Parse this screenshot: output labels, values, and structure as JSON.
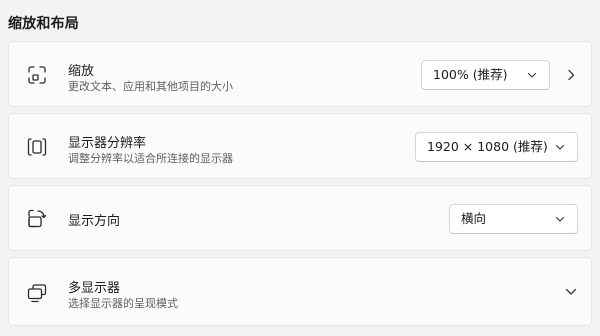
{
  "section": {
    "title": "缩放和布局"
  },
  "rows": [
    {
      "title": "缩放",
      "subtitle": "更改文本、应用和其他项目的大小",
      "icon": "scale-icon",
      "control": {
        "type": "dropdown",
        "value": "100% (推荐)"
      },
      "has_nav_chevron": true
    },
    {
      "title": "显示器分辨率",
      "subtitle": "调整分辨率以适合所连接的显示器",
      "icon": "resolution-icon",
      "control": {
        "type": "dropdown",
        "value": "1920 × 1080 (推荐)"
      }
    },
    {
      "title": "显示方向",
      "icon": "orientation-icon",
      "control": {
        "type": "dropdown",
        "value": "横向"
      }
    },
    {
      "title": "多显示器",
      "subtitle": "选择显示器的呈现模式",
      "icon": "multiple-displays-icon",
      "control": {
        "type": "expander"
      }
    }
  ],
  "colors": {
    "background": "#f3f3f3",
    "card": "#fbfbfb",
    "border": "#e5e5e5",
    "text": "#1b1b1b",
    "secondary_text": "#606060"
  }
}
